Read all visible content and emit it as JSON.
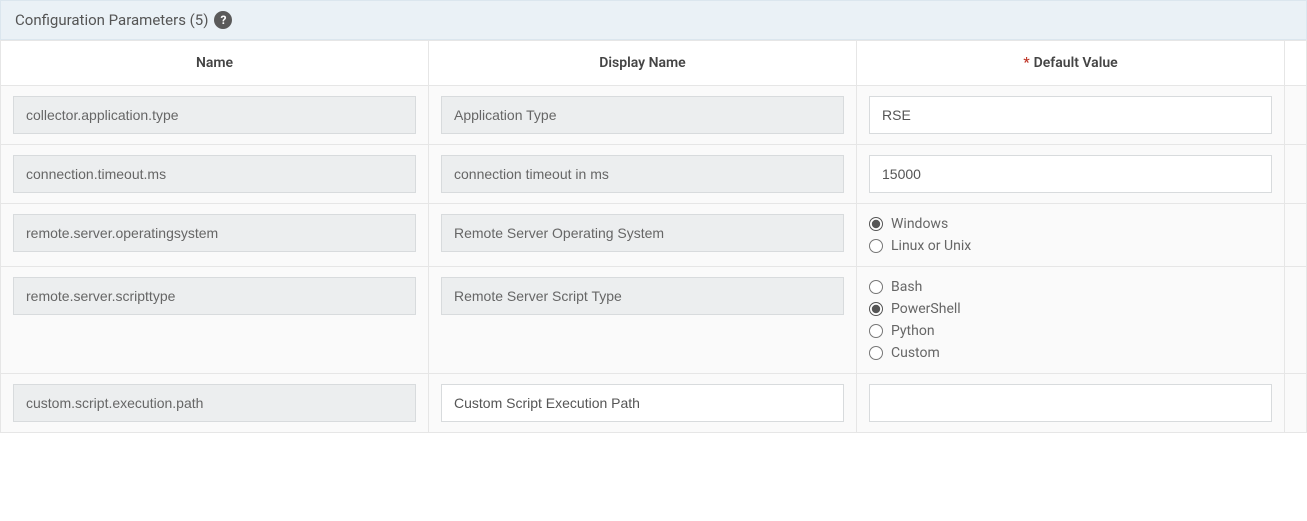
{
  "panel": {
    "title": "Configuration Parameters (5)"
  },
  "columns": {
    "name": "Name",
    "displayName": "Display Name",
    "defaultValue": "Default Value"
  },
  "rows": [
    {
      "name": "collector.application.type",
      "displayName": "Application Type",
      "type": "text",
      "value": "RSE",
      "nameReadonly": true,
      "displayReadonly": true
    },
    {
      "name": "connection.timeout.ms",
      "displayName": "connection timeout in ms",
      "type": "text",
      "value": "15000",
      "nameReadonly": true,
      "displayReadonly": true
    },
    {
      "name": "remote.server.operatingsystem",
      "displayName": "Remote Server Operating System",
      "type": "radio",
      "options": [
        "Windows",
        "Linux or Unix"
      ],
      "selected": "Windows",
      "nameReadonly": true,
      "displayReadonly": true
    },
    {
      "name": "remote.server.scripttype",
      "displayName": "Remote Server Script Type",
      "type": "radio",
      "options": [
        "Bash",
        "PowerShell",
        "Python",
        "Custom"
      ],
      "selected": "PowerShell",
      "nameReadonly": true,
      "displayReadonly": true
    },
    {
      "name": "custom.script.execution.path",
      "displayName": "Custom Script Execution Path",
      "type": "text",
      "value": "",
      "nameReadonly": true,
      "displayReadonly": false
    }
  ]
}
